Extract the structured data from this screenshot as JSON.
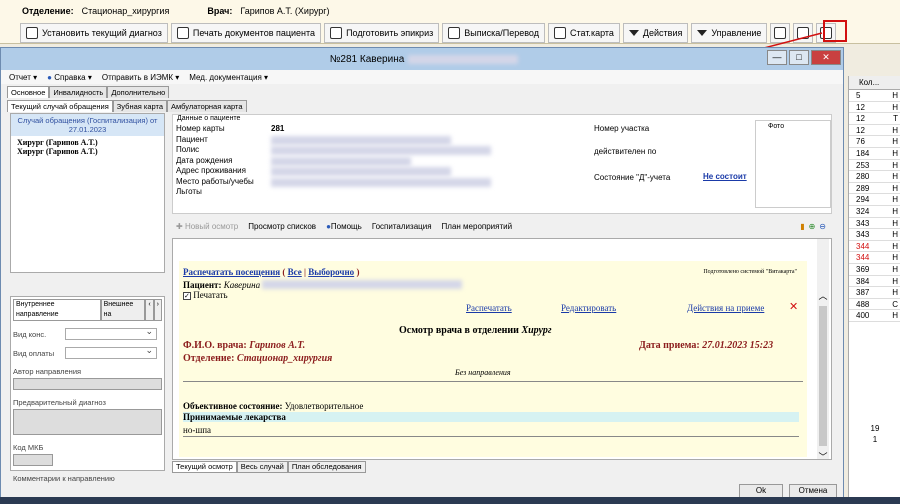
{
  "top": {
    "dept_label": "Отделение:",
    "dept_value": "Стационар_хирургия",
    "doctor_label": "Врач:",
    "doctor_value": "Гарипов А.Т. (Хирург)"
  },
  "toolbar": [
    {
      "label": "Установить текущий диагноз",
      "icon": "diagnosis-icon"
    },
    {
      "label": "Печать документов пациента",
      "icon": "people-print-icon"
    },
    {
      "label": "Подготовить эпикриз",
      "icon": "epicrisis-icon"
    },
    {
      "label": "Выписка/Перевод",
      "icon": "discharge-icon"
    },
    {
      "label": "Стат.карта",
      "icon": "stat-card-icon"
    },
    {
      "label": "Действия",
      "icon": "chevron-down-icon"
    },
    {
      "label": "Управление",
      "icon": "chevron-down-icon"
    }
  ],
  "right_column": {
    "header": "Кол...",
    "rows": [
      "5",
      "12",
      "12",
      "12",
      "76",
      "184",
      "253",
      "280",
      "289",
      "294",
      "324",
      "343",
      "343",
      "344",
      "344",
      "369",
      "384",
      "387",
      "488",
      "400"
    ],
    "row_letters": [
      "Н",
      "Н",
      "Т",
      "Н",
      "Н",
      "Н",
      "Н",
      "Н",
      "Н",
      "Н",
      "Н",
      "Н",
      "Н",
      "Н",
      "Н",
      "Н",
      "Н",
      "Н",
      "С",
      "Н"
    ],
    "red_rows": [
      13,
      14
    ],
    "footer": [
      "19",
      "1"
    ]
  },
  "window": {
    "title": "№281 Каверина",
    "menu": [
      "Отчет ▾",
      "Справка ▾",
      "Отправить в ИЭМК ▾",
      "Мед. документация ▾"
    ],
    "tabs_main": [
      "Основное",
      "Инвалидность",
      "Дополнительно"
    ],
    "tabs_sub": [
      "Текущий случай обращения",
      "Зубная карта",
      "Амбулаторная карта"
    ],
    "case_header": "Случай обращения (Госпитализация) от 27.01.2023",
    "tree": [
      "Хирург (Гарипов А.Т.)",
      "Хирург (Гарипов А.Т.)"
    ],
    "patient_legend": "Данные о пациенте",
    "patient_fields": [
      {
        "label": "Номер карты",
        "value": "281"
      },
      {
        "label": "Пациент",
        "value": ""
      },
      {
        "label": "Полис",
        "value": ""
      },
      {
        "label": "Дата рождения",
        "value": ""
      },
      {
        "label": "Адрес проживания",
        "value": ""
      },
      {
        "label": "Место работы/учебы",
        "value": ""
      },
      {
        "label": "Льготы",
        "value": ""
      }
    ],
    "area_label": "Номер участка",
    "valid_label": "действителен по",
    "d_state_label": "Состояние \"Д\"-учета",
    "d_state_value": "Не состоит",
    "photo_label": "Фото",
    "subtoolbar": [
      "Новый осмотр",
      "Просмотр списков",
      "Помощь",
      "Госпитализация",
      "План мероприятий"
    ],
    "left_tabs": [
      "Внутреннее направление",
      "Внешнее на"
    ],
    "left_fields": {
      "vid_kons": "Вид конс.",
      "vid_oplaty": "Вид оплаты",
      "author": "Автор направления",
      "prelim": "Предварительный диагноз",
      "mkb": "Код МКБ",
      "comments": "Комментарии к направлению"
    },
    "doc": {
      "print_visits": "Распечатать посещения",
      "all": "Все",
      "selective": "Выборочно",
      "prepared": "Подготовлено системой \"Витакарта\"",
      "patient_label": "Пациент:",
      "patient_name": "Каверина",
      "print_check": "Печатать",
      "print": "Распечатать",
      "edit": "Редактировать",
      "actions": "Действия на приеме",
      "exam_title": "Осмотр врача в отделении",
      "exam_specialty": "Хирург",
      "doctor_label": "Ф.И.О. врача:",
      "doctor_value": "Гарипов А.Т.",
      "date_label": "Дата приема:",
      "date_value": "27.01.2023 15:23",
      "dept_label": "Отделение:",
      "dept_value": "Стационар_хирургия",
      "no_referral": "Без направления",
      "objective_label": "Объективное состояние:",
      "objective_value": "Удовлетворительное",
      "drugs_header": "Принимаемые лекарства",
      "drug": "но-шпа"
    },
    "bottom_tabs": [
      "Текущий осмотр",
      "Весь случай",
      "План обследования"
    ],
    "ok": "Ok",
    "cancel": "Отмена"
  }
}
